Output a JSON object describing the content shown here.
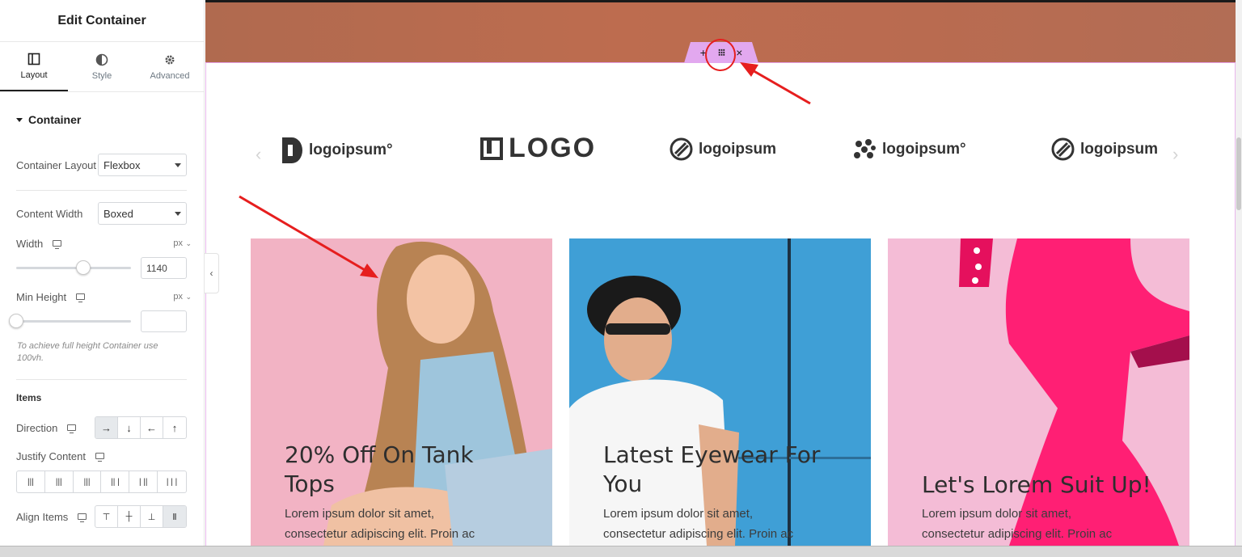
{
  "panel": {
    "title": "Edit Container",
    "tabs": [
      {
        "label": "Layout",
        "icon": "layout-icon"
      },
      {
        "label": "Style",
        "icon": "contrast-icon"
      },
      {
        "label": "Advanced",
        "icon": "gear-icon"
      }
    ],
    "section": "Container",
    "container_layout": {
      "label": "Container Layout",
      "value": "Flexbox"
    },
    "content_width": {
      "label": "Content Width",
      "value": "Boxed"
    },
    "width": {
      "label": "Width",
      "unit": "px",
      "value": "1140"
    },
    "min_height": {
      "label": "Min Height",
      "unit": "px",
      "value": ""
    },
    "hint": "To achieve full height Container use 100vh.",
    "items_heading": "Items",
    "direction_label": "Direction",
    "direction_buttons": [
      "→",
      "↓",
      "←",
      "↑"
    ],
    "justify_label": "Justify Content",
    "align_label": "Align Items",
    "collapse": "‹"
  },
  "canvas": {
    "handle": {
      "add": "+",
      "move": "⁝⁝⁝",
      "close": "×"
    },
    "prev_arrow": "‹",
    "next_arrow": "›",
    "logos": [
      {
        "text": "logoipsum°",
        "icon": "half-circle-logo-icon"
      },
      {
        "text": "LOGO",
        "icon": "square-logo-icon"
      },
      {
        "text": "logoipsum",
        "icon": "circle-stripe-logo-icon"
      },
      {
        "text": "logoipsum°",
        "icon": "dots-logo-icon"
      },
      {
        "text": "logoipsum",
        "icon": "circle-stripe-logo-icon"
      }
    ],
    "cards": [
      {
        "title_line1": "20% Off On Tank",
        "title_line2": "Tops",
        "desc_line1": "Lorem ipsum dolor sit amet,",
        "desc_line2": "consectetur adipiscing elit. Proin ac"
      },
      {
        "title_line1": "Latest Eyewear For",
        "title_line2": "You",
        "desc_line1": "Lorem ipsum dolor sit amet,",
        "desc_line2": "consectetur adipiscing elit. Proin ac"
      },
      {
        "title_line1": "Let's Lorem Suit Up!",
        "desc_line1": "Lorem ipsum dolor sit amet,",
        "desc_line2": "consectetur adipiscing elit. Proin ac"
      }
    ]
  },
  "colors": {
    "hero": "#b96b50",
    "handle": "#e2a8ef",
    "card1": "#f2b3c4",
    "card2": "#3f9fd6",
    "card3": "#f4bcd6",
    "annotation": "#e61e1e"
  }
}
